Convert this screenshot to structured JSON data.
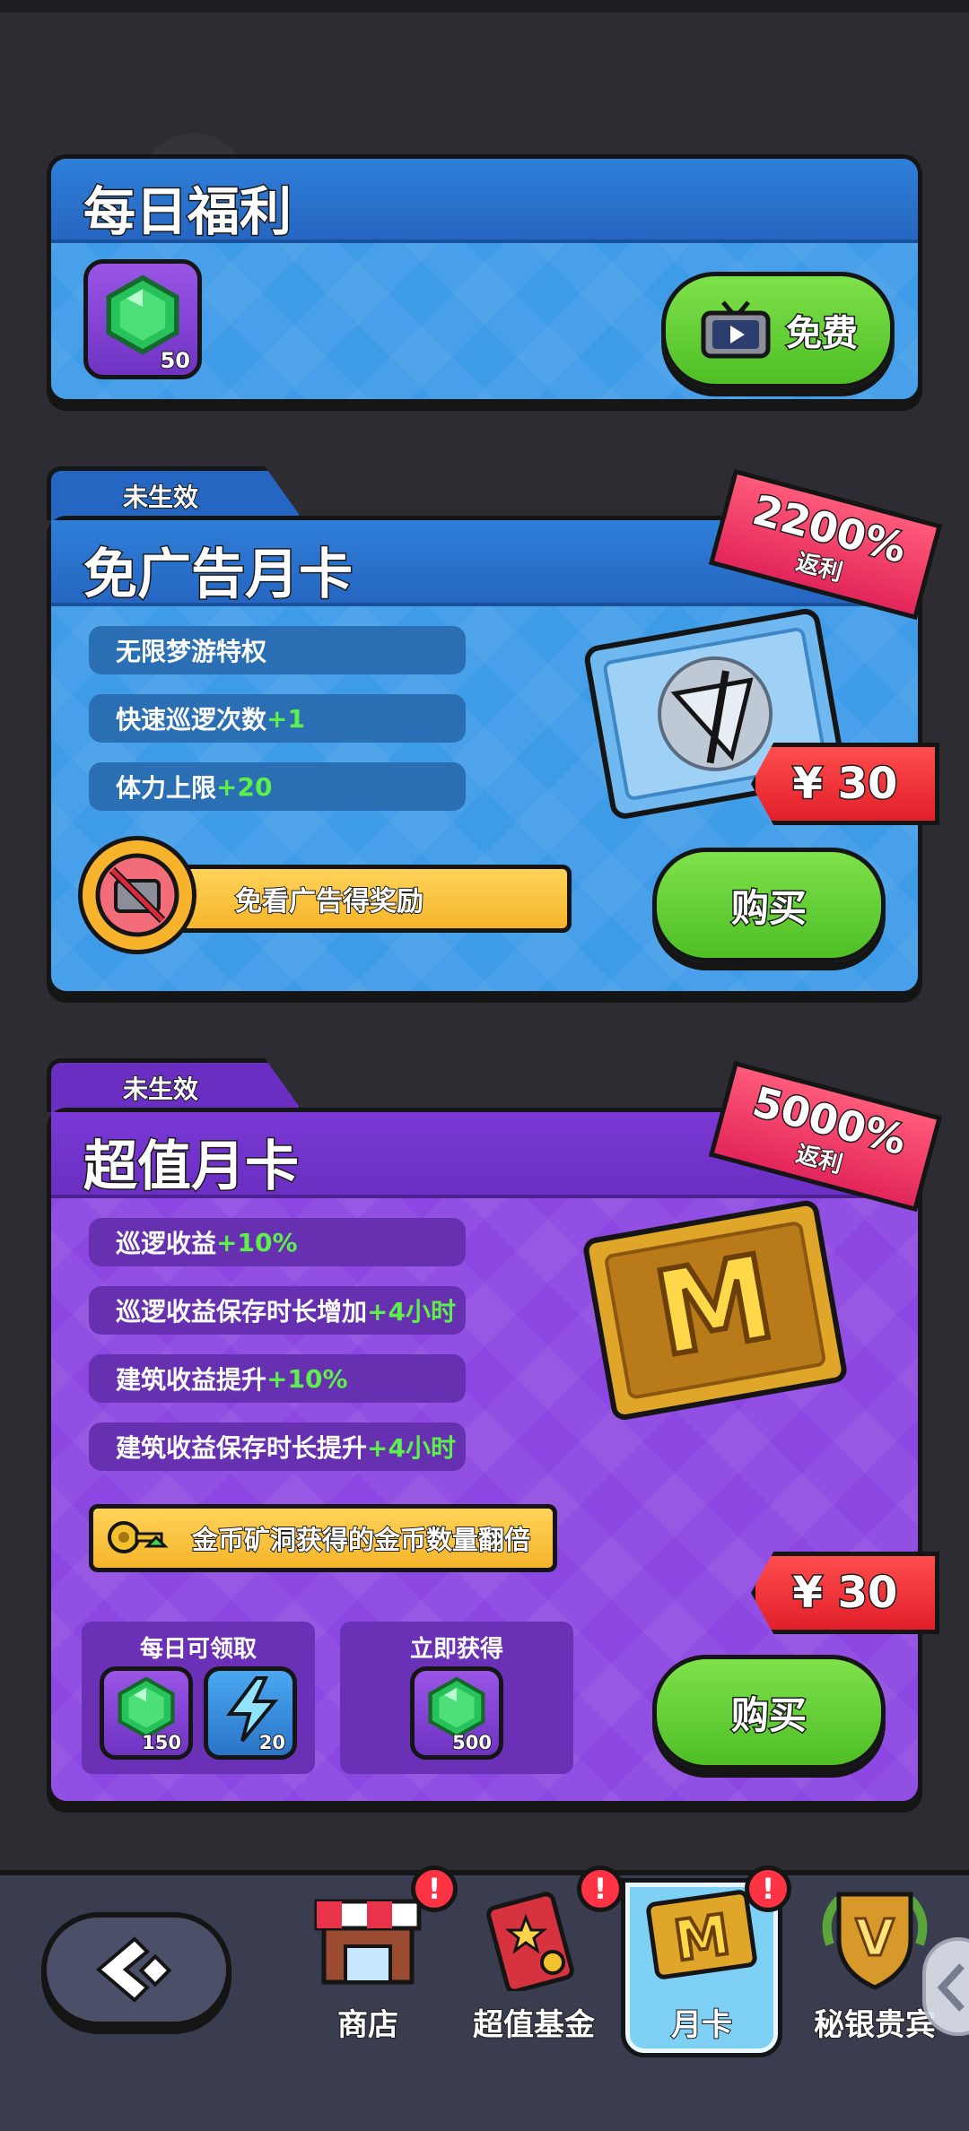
{
  "daily": {
    "title": "每日福利",
    "gem_qty": "50",
    "free_label": "免费"
  },
  "noad_card": {
    "status": "未生效",
    "title": "免广告月卡",
    "rebate_pct": "2200%",
    "rebate_label": "返利",
    "perks": [
      {
        "text": "无限梦游特权",
        "plus": ""
      },
      {
        "text": "快速巡逻次数",
        "plus": "+1"
      },
      {
        "text": "体力上限",
        "plus": "+20"
      }
    ],
    "banner": "免看广告得奖励",
    "price": "¥ 30",
    "buy_label": "购买"
  },
  "value_card": {
    "status": "未生效",
    "title": "超值月卡",
    "rebate_pct": "5000%",
    "rebate_label": "返利",
    "perks": [
      {
        "text": "巡逻收益",
        "plus": "+10%"
      },
      {
        "text": "巡逻收益保存时长增加",
        "plus": "+4小时"
      },
      {
        "text": "建筑收益提升",
        "plus": "+10%"
      },
      {
        "text": "建筑收益保存时长提升",
        "plus": "+4小时"
      }
    ],
    "banner": "金币矿洞获得的金币数量翻倍",
    "daily_label": "每日可领取",
    "daily_gem_qty": "150",
    "daily_energy_qty": "20",
    "instant_label": "立即获得",
    "instant_gem_qty": "500",
    "price": "¥ 30",
    "buy_label": "购买"
  },
  "nav": {
    "items": [
      {
        "label": "商店",
        "icon": "shop-icon"
      },
      {
        "label": "超值基金",
        "icon": "fund-icon"
      },
      {
        "label": "月卡",
        "icon": "monthly-card-icon"
      },
      {
        "label": "秘银贵宾",
        "icon": "vip-icon"
      }
    ],
    "badge": "!",
    "active_index": 2
  },
  "colors": {
    "blue_card": "#2f8fe3",
    "purple_card": "#8a43e0",
    "green_button": "#5fcd33",
    "price_red": "#e8232c",
    "ribbon_pink": "#e8336a"
  }
}
